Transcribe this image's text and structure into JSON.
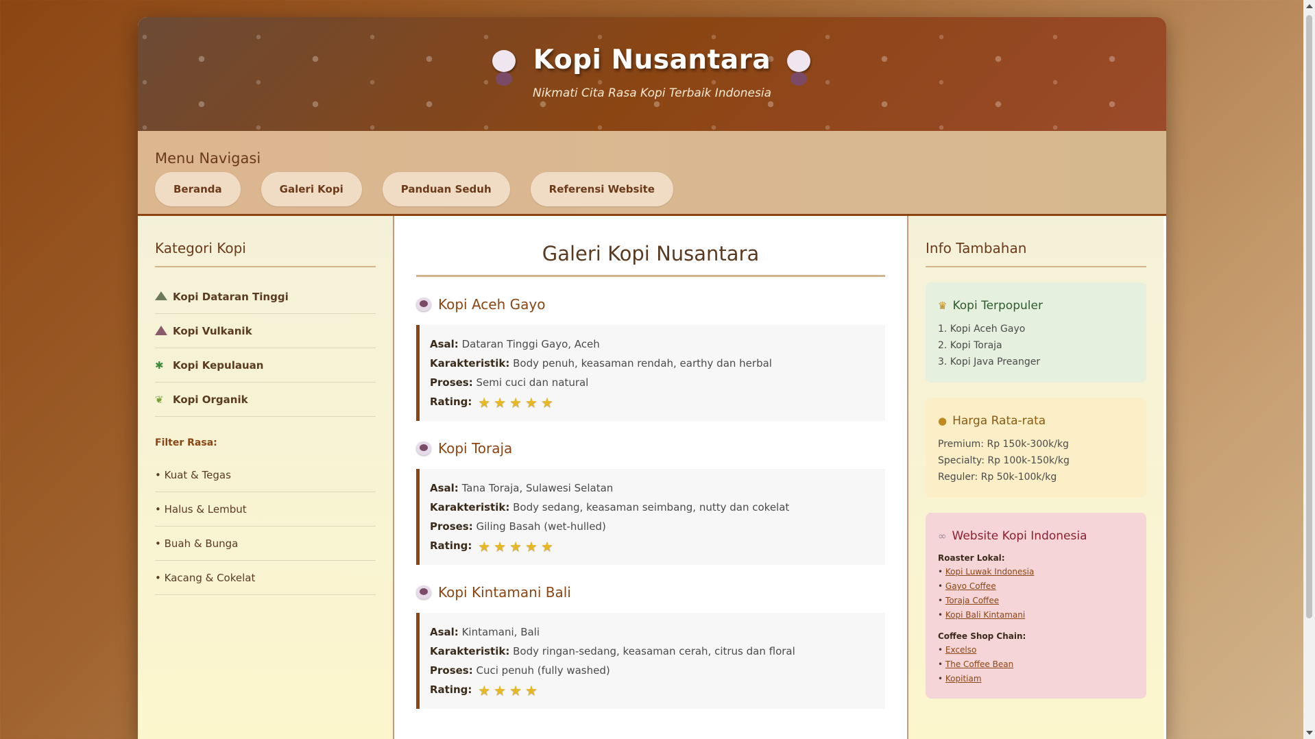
{
  "header": {
    "title": "Kopi Nusantara",
    "subtitle": "Nikmati Cita Rasa Kopi Terbaik Indonesia"
  },
  "nav": {
    "heading": "Menu Navigasi",
    "buttons": [
      "Beranda",
      "Galeri Kopi",
      "Panduan Seduh",
      "Referensi Website"
    ]
  },
  "left": {
    "title": "Kategori Kopi",
    "categories": [
      {
        "label": "Kopi Dataran Tinggi",
        "icon": "mountain-icon"
      },
      {
        "label": "Kopi Vulkanik",
        "icon": "volcano-icon"
      },
      {
        "label": "Kopi Kepulauan",
        "icon": "palm-tree-icon"
      },
      {
        "label": "Kopi Organik",
        "icon": "leaf-icon"
      }
    ],
    "filter_label": "Filter Rasa:",
    "filters": [
      "• Kuat & Tegas",
      "• Halus & Lembut",
      "• Buah & Bunga",
      "• Kacang & Cokelat"
    ]
  },
  "gallery": {
    "title": "Galeri Kopi Nusantara",
    "labels": {
      "origin": "Asal:",
      "character": "Karakteristik:",
      "process": "Proses:",
      "rating": "Rating:"
    },
    "coffees": [
      {
        "name": "Kopi Aceh Gayo",
        "origin": "Dataran Tinggi Gayo, Aceh",
        "character": "Body penuh, keasaman rendah, earthy dan herbal",
        "process": "Semi cuci dan natural",
        "rating": 5
      },
      {
        "name": "Kopi Toraja",
        "origin": "Tana Toraja, Sulawesi Selatan",
        "character": "Body sedang, keasaman seimbang, nutty dan cokelat",
        "process": "Giling Basah (wet-hulled)",
        "rating": 5
      },
      {
        "name": "Kopi Kintamani Bali",
        "origin": "Kintamani, Bali",
        "character": "Body ringan-sedang, keasaman cerah, citrus dan floral",
        "process": "Cuci penuh (fully washed)",
        "rating": 4
      }
    ]
  },
  "right": {
    "title": "Info Tambahan",
    "popular": {
      "title": "Kopi Terpopuler",
      "items": [
        "1. Kopi Aceh Gayo",
        "2. Kopi Toraja",
        "3. Kopi Java Preanger"
      ]
    },
    "price": {
      "title": "Harga Rata-rata",
      "items": [
        "Premium: Rp 150k-300k/kg",
        "Specialty: Rp 100k-150k/kg",
        "Reguler: Rp 50k-100k/kg"
      ]
    },
    "websites": {
      "title": "Website Kopi Indonesia",
      "roaster_label": "Roaster Lokal:",
      "roasters": [
        "Kopi Luwak Indonesia",
        "Gayo Coffee",
        "Toraja Coffee",
        "Kopi Bali Kintamani"
      ],
      "chain_label": "Coffee Shop Chain:",
      "chains": [
        "Excelso",
        "The Coffee Bean",
        "Kopitiam"
      ]
    }
  },
  "colors": {
    "brand": "#8b4513",
    "star": "#e8b820"
  }
}
